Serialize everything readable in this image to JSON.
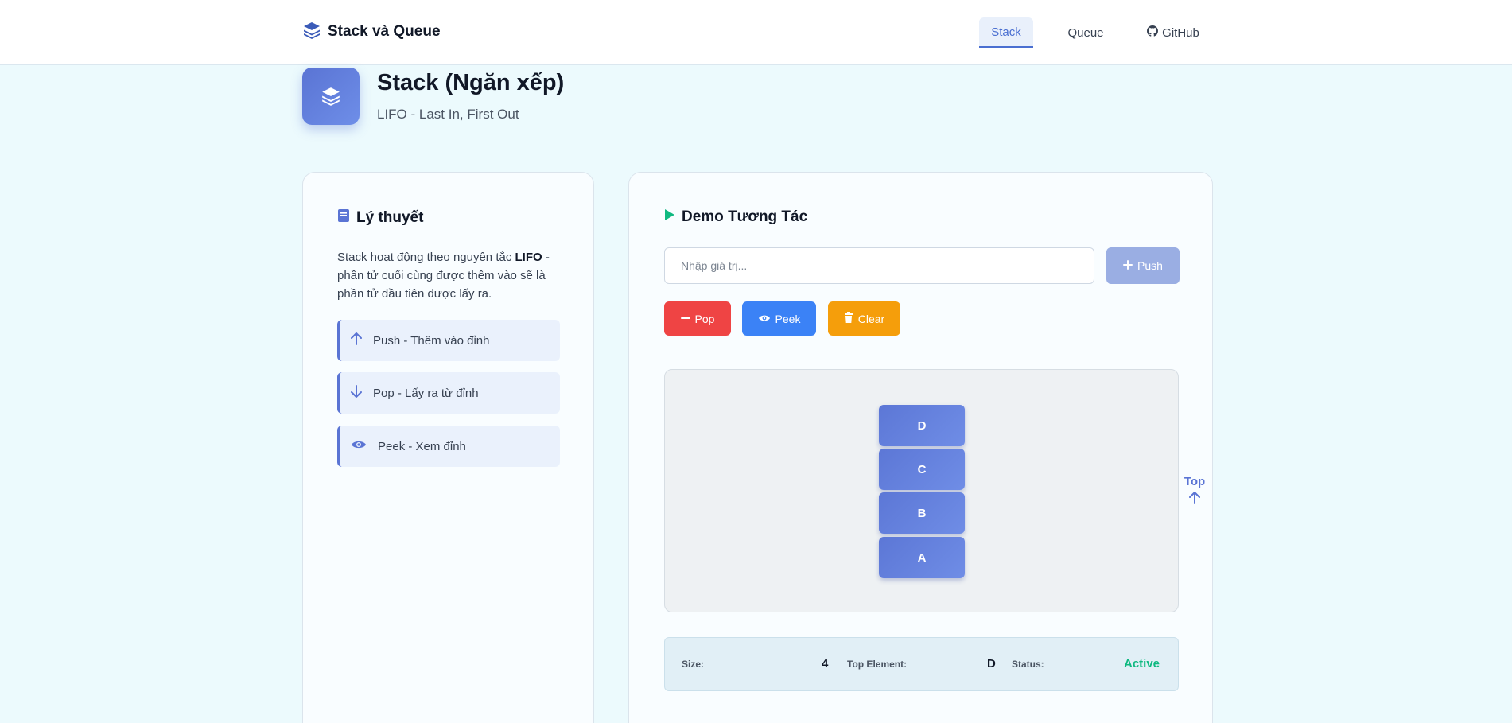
{
  "nav": {
    "brand": "Stack và Queue",
    "items": [
      {
        "label": "Stack",
        "active": true
      },
      {
        "label": "Queue",
        "active": false
      },
      {
        "label": "GitHub",
        "active": false
      }
    ]
  },
  "header": {
    "title": "Stack (Ngăn xếp)",
    "subtitle": "LIFO - Last In, First Out"
  },
  "theory": {
    "title": "Lý thuyết",
    "text_before": "Stack hoạt động theo nguyên tắc ",
    "text_bold": "LIFO",
    "text_after": " - phần tử cuối cùng được thêm vào sẽ là phần tử đầu tiên được lấy ra.",
    "operations": [
      {
        "icon": "arrow-up-icon",
        "label": "Push - Thêm vào đỉnh"
      },
      {
        "icon": "arrow-down-icon",
        "label": "Pop - Lấy ra từ đỉnh"
      },
      {
        "icon": "eye-icon",
        "label": "Peek - Xem đỉnh"
      }
    ]
  },
  "demo": {
    "title": "Demo Tương Tác",
    "input_placeholder": "Nhập giá trị...",
    "input_value": "",
    "push_label": "Push",
    "pop_label": "Pop",
    "peek_label": "Peek",
    "clear_label": "Clear",
    "stack_elements": [
      "D",
      "C",
      "B",
      "A"
    ],
    "top_label": "Top",
    "stats": {
      "size_label": "Size:",
      "size_value": "4",
      "top_label": "Top Element:",
      "top_value": "D",
      "status_label": "Status:",
      "status_value": "Active"
    }
  },
  "colors": {
    "accent": "#5a74d4",
    "pop": "#ef4444",
    "peek": "#3b82f6",
    "clear": "#f59e0b",
    "status_active": "#10b981"
  }
}
